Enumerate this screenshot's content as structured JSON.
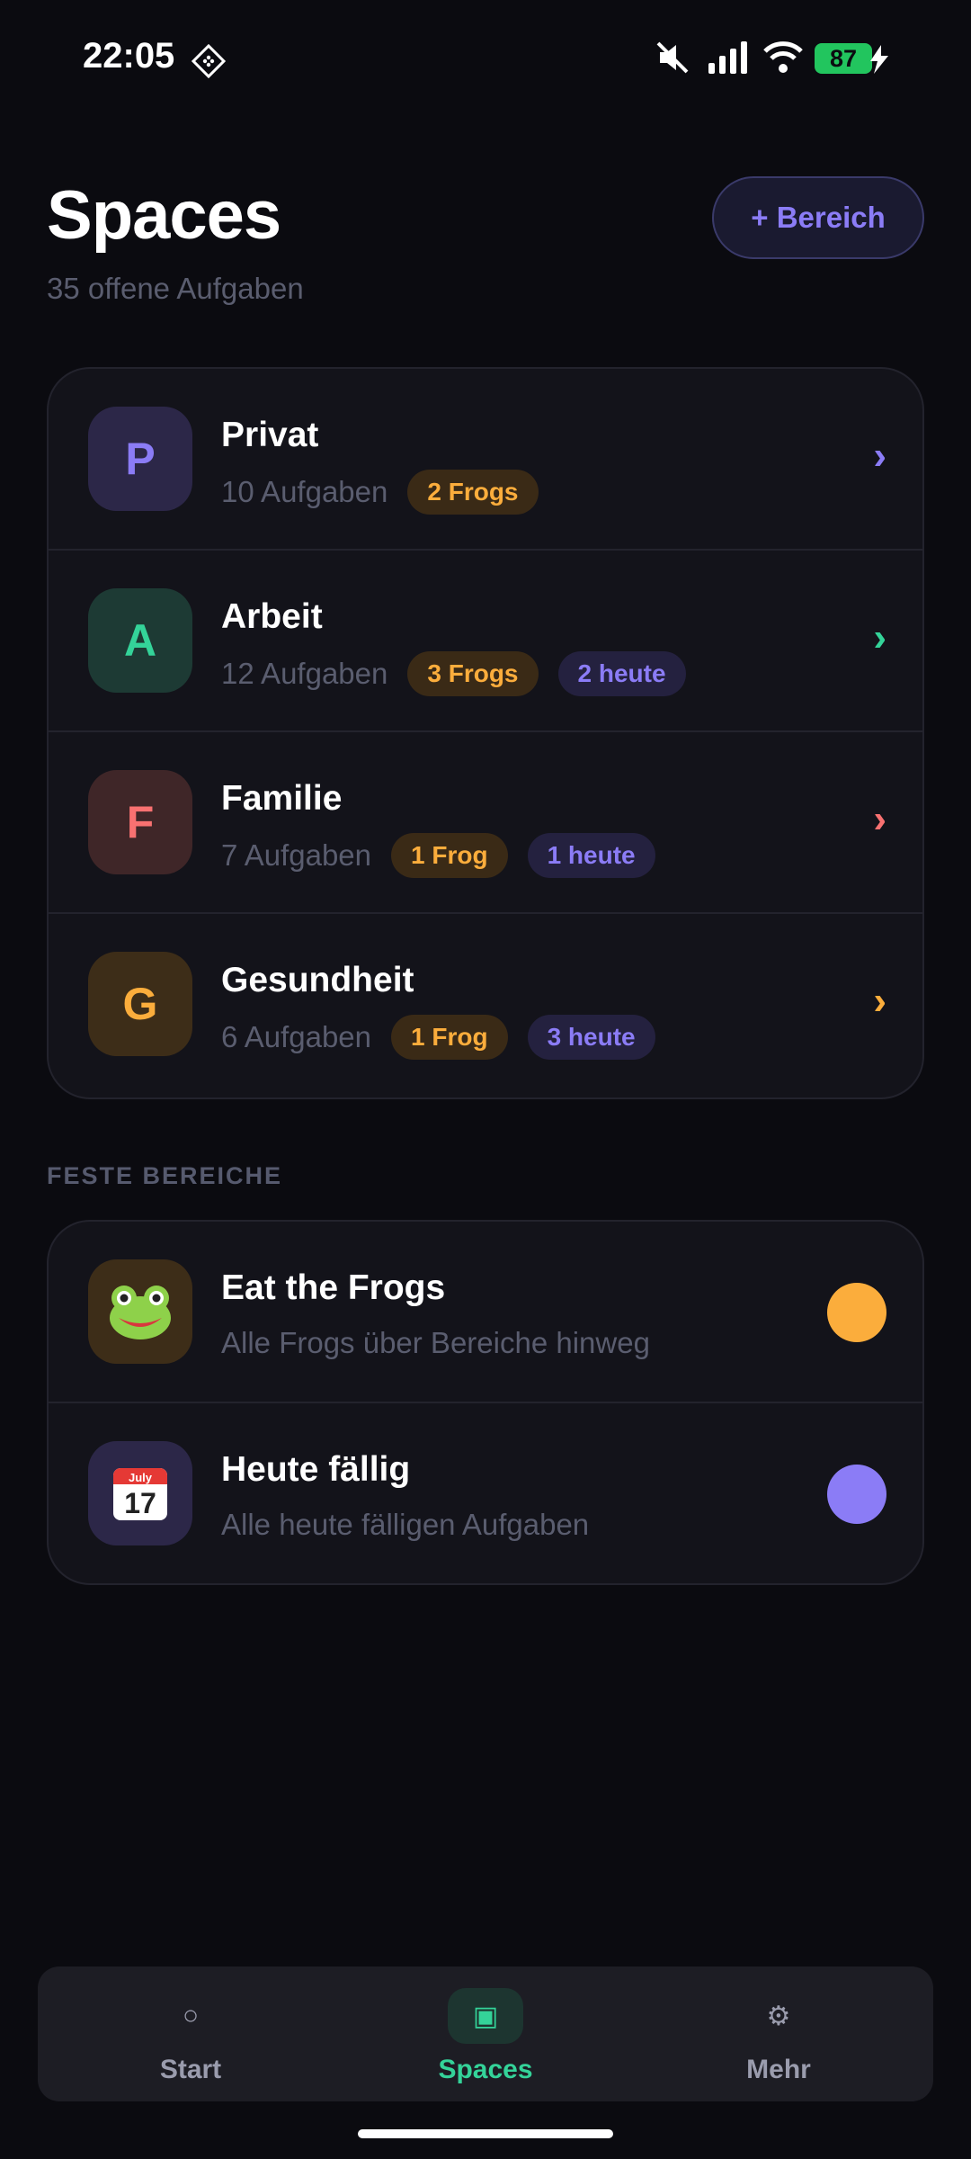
{
  "status_bar": {
    "time": "22:05",
    "battery": "87"
  },
  "header": {
    "title": "Spaces",
    "subtitle": "35 offene Aufgaben",
    "add_button": "+ Bereich"
  },
  "spaces": [
    {
      "initial": "P",
      "name": "Privat",
      "count": "10 Aufgaben",
      "frogs": "2 Frogs",
      "today": "",
      "color": "#8b7cf6",
      "bg": "#2c2748"
    },
    {
      "initial": "A",
      "name": "Arbeit",
      "count": "12 Aufgaben",
      "frogs": "3 Frogs",
      "today": "2 heute",
      "color": "#34d399",
      "bg": "#1d3a34"
    },
    {
      "initial": "F",
      "name": "Familie",
      "count": "7 Aufgaben",
      "frogs": "1 Frog",
      "today": "1 heute",
      "color": "#f87171",
      "bg": "#3f2628"
    },
    {
      "initial": "G",
      "name": "Gesundheit",
      "count": "6 Aufgaben",
      "frogs": "1 Frog",
      "today": "3 heute",
      "color": "#fbad3c",
      "bg": "#3d2d18"
    }
  ],
  "fixed_section": {
    "label": "FESTE BEREICHE",
    "items": [
      {
        "icon": "frog-icon",
        "name": "Eat the Frogs",
        "desc": "Alle Frogs über Bereiche hinweg",
        "dot_color": "#fbad3c"
      },
      {
        "icon": "calendar-icon",
        "name": "Heute fällig",
        "desc": "Alle heute fälligen Aufgaben",
        "dot_color": "#8b7cf6",
        "calendar_month": "July",
        "calendar_day": "17"
      }
    ]
  },
  "nav": [
    {
      "label": "Start",
      "icon": "circle-icon",
      "active": false
    },
    {
      "label": "Spaces",
      "icon": "square-icon",
      "active": true
    },
    {
      "label": "Mehr",
      "icon": "gear-icon",
      "active": false
    }
  ]
}
